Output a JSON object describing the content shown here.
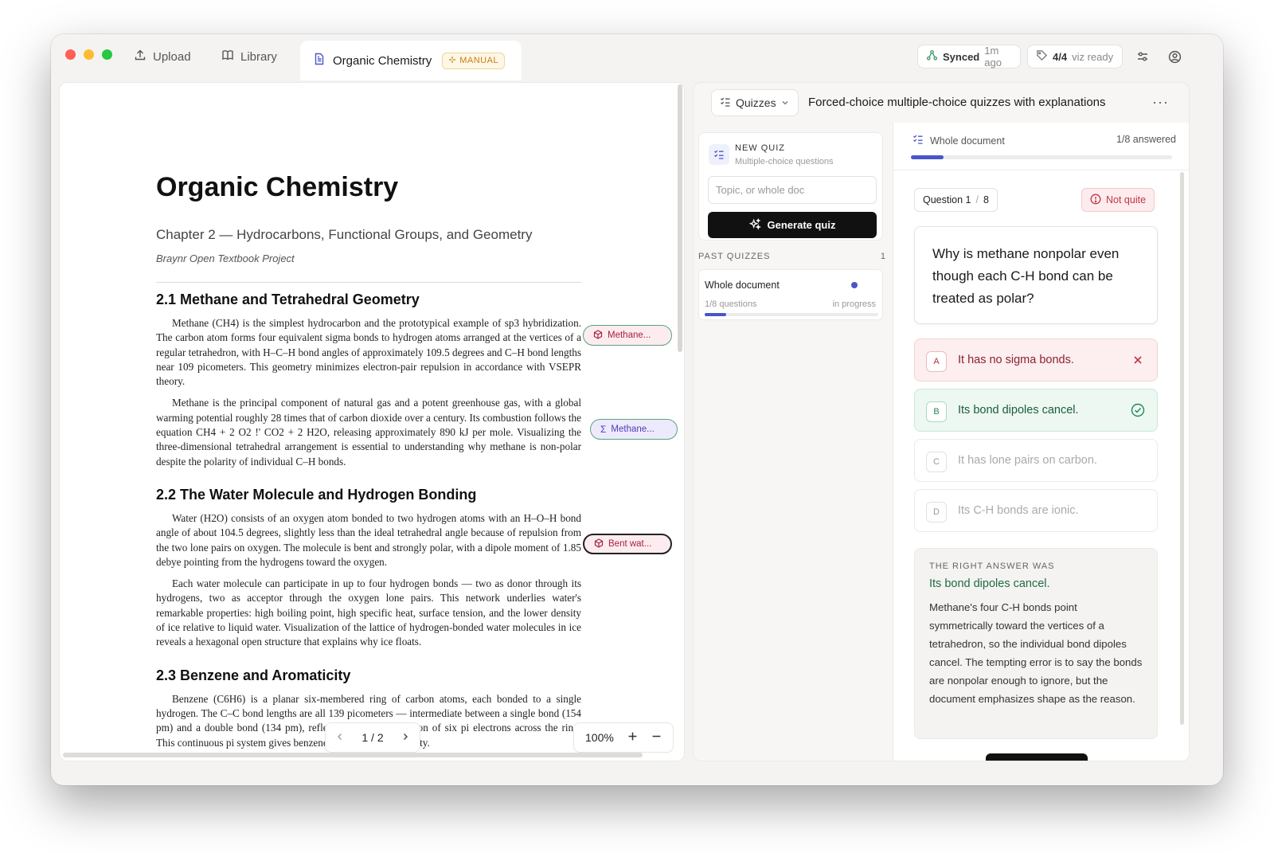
{
  "tabs": {
    "upload": "Upload",
    "library": "Library",
    "active_doc": "Organic Chemistry",
    "manual_badge": "MANUAL"
  },
  "status": {
    "sync_label": "Synced",
    "sync_time": "1m ago",
    "viz_count": "4/4",
    "viz_label": "viz ready"
  },
  "document": {
    "title": "Organic Chemistry",
    "subtitle": "Chapter 2 — Hydrocarbons, Functional Groups, and Geometry",
    "byline": "Braynr Open Textbook Project",
    "sections": [
      {
        "heading": "2.1  Methane and Tetrahedral Geometry",
        "paragraphs": [
          "Methane (CH4) is the simplest hydrocarbon and the prototypical example of sp3 hybridization. The carbon atom forms four equivalent sigma bonds to hydrogen atoms arranged at the vertices of a regular tetrahedron, with H–C–H bond angles of approximately 109.5 degrees and C–H bond lengths near 109 picometers. This geometry minimizes electron-pair repulsion in accordance with VSEPR theory.",
          "Methane is the principal component of natural gas and a potent greenhouse gas, with a global warming potential roughly 28 times that of carbon dioxide over a century. Its combustion follows the equation CH4 + 2 O2 !' CO2 + 2 H2O, releasing approximately 890 kJ per mole. Visualizing the three-dimensional tetrahedral arrangement is essential to understanding why methane is non-polar despite the polarity of individual C–H bonds."
        ]
      },
      {
        "heading": "2.2  The Water Molecule and Hydrogen Bonding",
        "paragraphs": [
          "Water (H2O) consists of an oxygen atom bonded to two hydrogen atoms with an H–O–H bond angle of about 104.5 degrees, slightly less than the ideal tetrahedral angle because of repulsion from the two lone pairs on oxygen. The molecule is bent and strongly polar, with a dipole moment of 1.85 debye pointing from the hydrogens toward the oxygen.",
          "Each water molecule can participate in up to four hydrogen bonds — two as donor through its hydrogens, two as acceptor through the oxygen lone pairs. This network underlies water's remarkable properties: high boiling point, high specific heat, surface tension, and the lower density of ice relative to liquid water. Visualization of the lattice of hydrogen-bonded water molecules in ice reveals a hexagonal open structure that explains why ice floats."
        ]
      },
      {
        "heading": "2.3  Benzene and Aromaticity",
        "paragraphs": [
          "Benzene (C6H6) is a planar six-membered ring of carbon atoms, each bonded to a single hydrogen. The C–C bond lengths are all 139 picometers — intermediate between a single bond (154 pm) and a double bond (134 pm), reflecting the delocalization of six pi electrons across the ring. This continuous pi system gives benzene its exceptional stability."
        ]
      }
    ],
    "annotations": [
      {
        "label": "Methane...",
        "kind": "model"
      },
      {
        "label": "Methane...",
        "kind": "formula"
      },
      {
        "label": "Bent wat...",
        "kind": "model"
      }
    ],
    "pager": "1 / 2",
    "zoom": "100%"
  },
  "right_panel": {
    "mode": "Quizzes",
    "title": "Forced-choice multiple-choice quizzes with explanations",
    "new_quiz": {
      "title": "NEW QUIZ",
      "subtitle": "Multiple-choice questions",
      "placeholder": "Topic, or whole doc",
      "button": "Generate quiz"
    },
    "past": {
      "header": "PAST QUIZZES",
      "count": "1",
      "items": [
        {
          "title": "Whole document",
          "questions": "1/8 questions",
          "status": "in progress",
          "progress": 0.125
        }
      ]
    },
    "quiz": {
      "scope": "Whole document",
      "answered": "1/8 answered",
      "progress": 0.125,
      "question_label": "Question 1",
      "question_total": "8",
      "result": "Not quite",
      "question": "Why is methane nonpolar even though each C-H bond can be treated as polar?",
      "options": [
        {
          "letter": "A",
          "text": "It has no sigma bonds.",
          "state": "wrong"
        },
        {
          "letter": "B",
          "text": "Its bond dipoles cancel.",
          "state": "correct"
        },
        {
          "letter": "C",
          "text": "It has lone pairs on carbon.",
          "state": "neutral"
        },
        {
          "letter": "D",
          "text": "Its C-H bonds are ionic.",
          "state": "neutral"
        }
      ],
      "explanation_label": "THE RIGHT ANSWER WAS",
      "explanation_answer": "Its bond dipoles cancel.",
      "explanation_body": "Methane's four C-H bonds point symmetrically toward the vertices of a tetrahedron, so the individual bond dipoles cancel. The tempting error is to say the bonds are nonpolar enough to ignore, but the document emphasizes shape as the reason."
    }
  },
  "colors": {
    "accent": "#4a55c9",
    "error": "#c23445",
    "success": "#22875a",
    "manual": "#c77d10"
  }
}
